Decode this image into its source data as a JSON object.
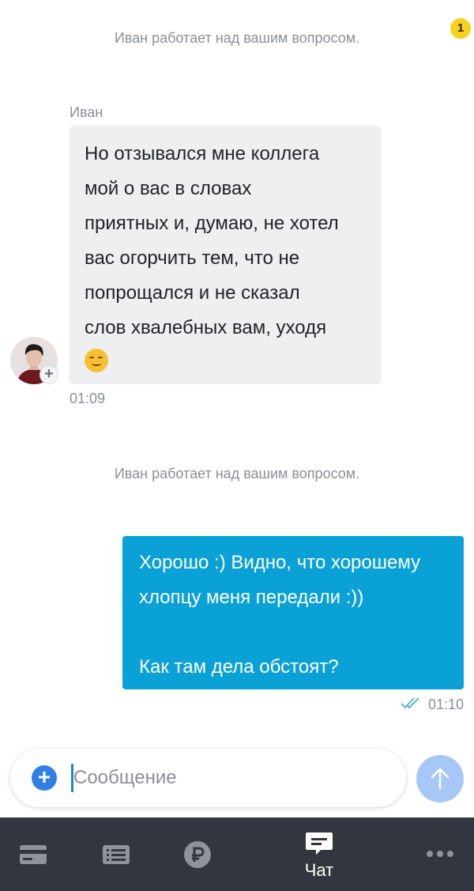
{
  "chat": {
    "system_note_1": "Иван работает над вашим вопросом.",
    "incoming": {
      "sender": "Иван",
      "lines": [
        "Но отзывался мне коллега",
        "мой о вас в словах",
        "приятных и, думаю, не хотел",
        "вас огорчить тем, что не",
        "попрощался и не сказал",
        "слов хвалебных вам, уходя"
      ],
      "emoji": "smiling-face",
      "time": "01:09"
    },
    "system_note_2": "Иван работает над вашим вопросом.",
    "outgoing": {
      "lines": [
        "Хорошо :) Видно, что хорошему",
        "хлопцу меня передали :))",
        "",
        "Как там дела обстоят?"
      ],
      "time": "01:10",
      "status": "read"
    }
  },
  "composer": {
    "placeholder": "Сообщение",
    "value": ""
  },
  "tabbar": {
    "tabs": [
      {
        "icon": "card-icon",
        "label": ""
      },
      {
        "icon": "list-icon",
        "label": ""
      },
      {
        "icon": "ruble-icon",
        "label": ""
      },
      {
        "icon": "chat-icon",
        "label": "Чат",
        "active": true
      },
      {
        "icon": "more-icon",
        "label": ""
      }
    ],
    "more_badge": "1"
  },
  "colors": {
    "incoming_bubble": "#eeeff1",
    "outgoing_bubble": "#0aa2d6",
    "tabbar_bg": "#33363e",
    "badge": "#f7d21c",
    "send_button": "#a7c8f7",
    "add_button": "#2f7fe4"
  }
}
